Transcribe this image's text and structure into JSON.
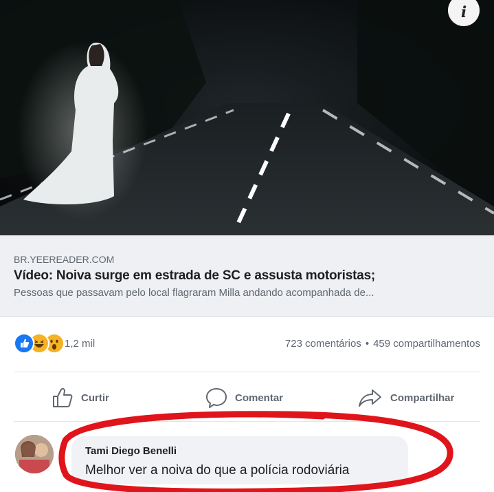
{
  "link_preview": {
    "domain": "BR.YEEREADER.COM",
    "headline": "Vídeo: Noiva surge em estrada de SC e assusta motoristas;",
    "description": "Pessoas que passavam pelo local flagraram Milla andando acompanhada de...",
    "info_icon": "i"
  },
  "reactions": {
    "icons": [
      "like-icon",
      "haha-icon",
      "wow-icon"
    ],
    "count": "1,2 mil",
    "comments": "723 comentários",
    "separator": "•",
    "shares": "459 compartilhamentos"
  },
  "actions": {
    "like": "Curtir",
    "comment": "Comentar",
    "share": "Compartilhar"
  },
  "comment": {
    "author": "Tami Diego Benelli",
    "text": "Melhor ver a noiva do que a polícia rodoviária"
  },
  "colors": {
    "like_blue": "#1877f2",
    "emoji_yellow": "#f7b125",
    "annotation_red": "#e0141b",
    "text_secondary": "#606770"
  }
}
